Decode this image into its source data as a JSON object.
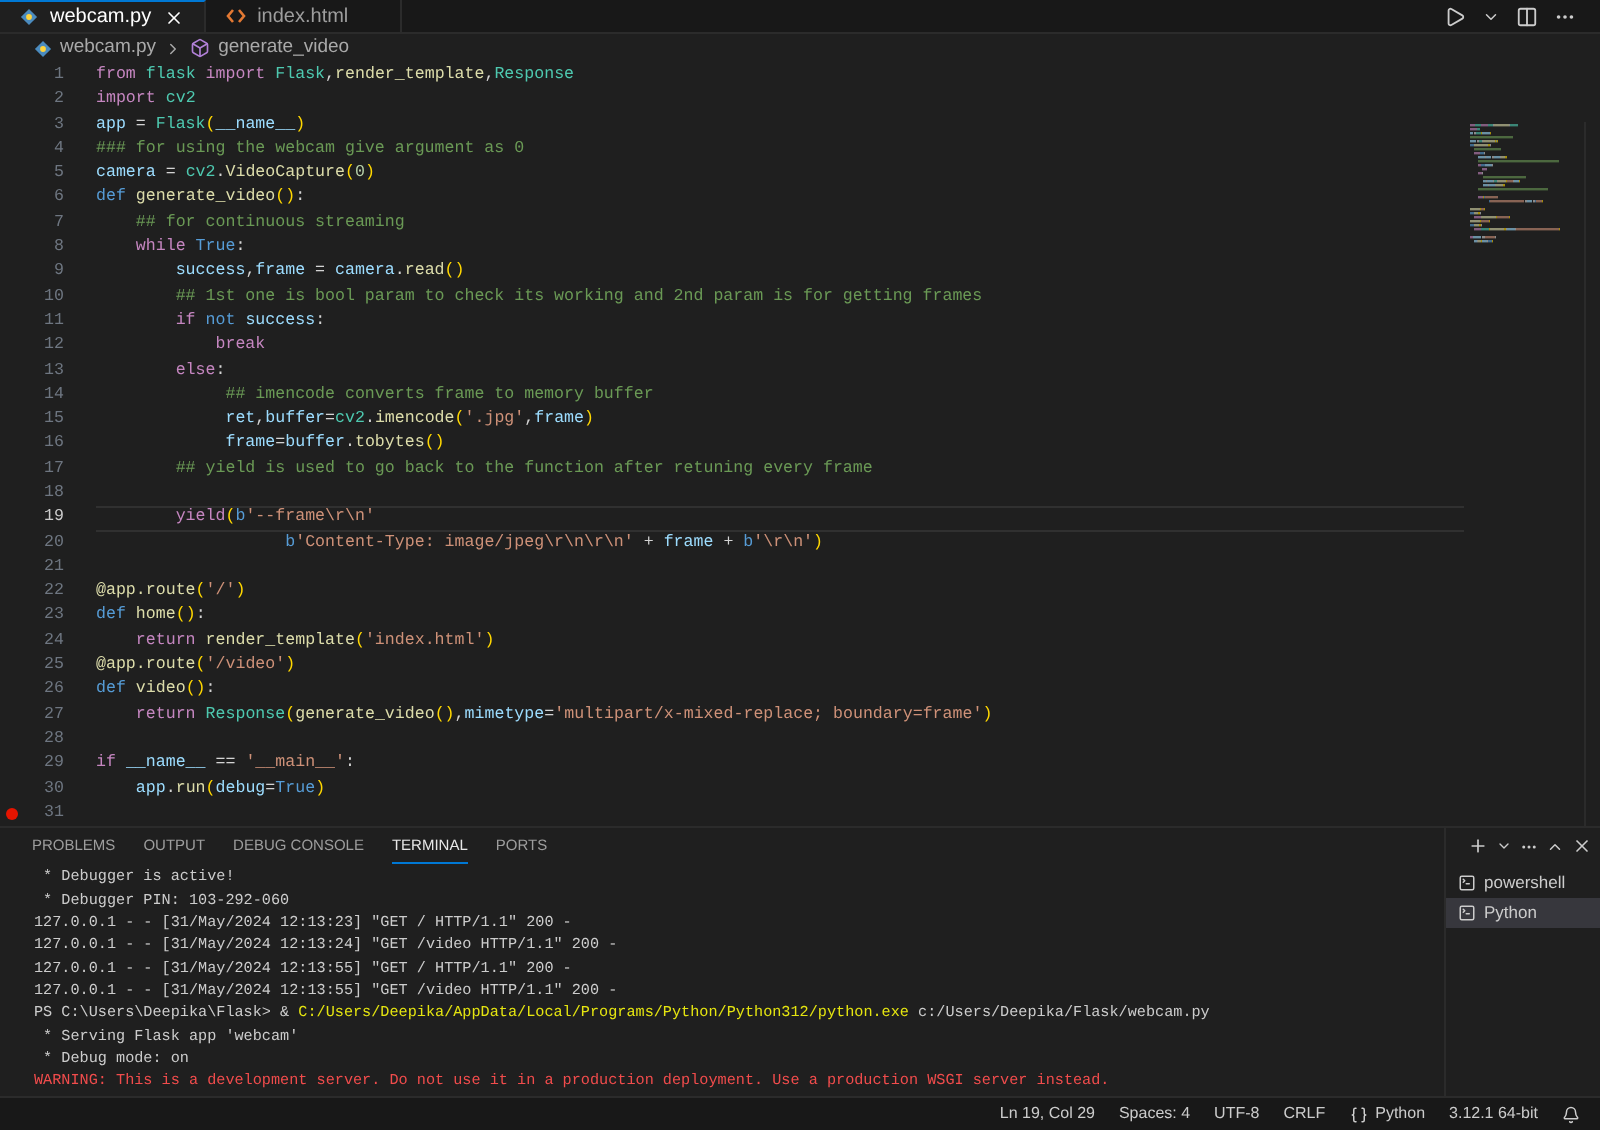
{
  "editor_tabs": [
    {
      "label": "webcam.py",
      "kind": "python",
      "selected": true
    },
    {
      "label": "index.html",
      "kind": "html",
      "selected": false
    }
  ],
  "breadcrumb": [
    {
      "label": "webcam.py",
      "kind": "python"
    },
    {
      "label": "generate_video",
      "kind": "symbol"
    }
  ],
  "code_lines": [
    {
      "number": "1",
      "current": false,
      "breakpoint": false,
      "tokens": [
        {
          "kind": "kw",
          "text": "from "
        },
        {
          "kind": "cls",
          "text": "flask "
        },
        {
          "kind": "kw",
          "text": "import "
        },
        {
          "kind": "cls",
          "text": "Flask"
        },
        {
          "kind": "plain",
          "text": ","
        },
        {
          "kind": "fn",
          "text": "render_template"
        },
        {
          "kind": "plain",
          "text": ","
        },
        {
          "kind": "cls",
          "text": "Response"
        }
      ]
    },
    {
      "number": "2",
      "current": false,
      "breakpoint": false,
      "tokens": [
        {
          "kind": "kw",
          "text": "import "
        },
        {
          "kind": "cls",
          "text": "cv2"
        }
      ]
    },
    {
      "number": "3",
      "current": false,
      "breakpoint": false,
      "tokens": [
        {
          "kind": "var",
          "text": "app"
        },
        {
          "kind": "plain",
          "text": " = "
        },
        {
          "kind": "cls",
          "text": "Flask"
        },
        {
          "kind": "br",
          "text": "("
        },
        {
          "kind": "var",
          "text": "__name__"
        },
        {
          "kind": "br",
          "text": ")"
        }
      ]
    },
    {
      "number": "4",
      "current": false,
      "breakpoint": false,
      "tokens": [
        {
          "kind": "cm",
          "text": "### for using the webcam give argument as 0"
        }
      ]
    },
    {
      "number": "5",
      "current": false,
      "breakpoint": false,
      "tokens": [
        {
          "kind": "var",
          "text": "camera"
        },
        {
          "kind": "plain",
          "text": " = "
        },
        {
          "kind": "cls",
          "text": "cv2"
        },
        {
          "kind": "plain",
          "text": "."
        },
        {
          "kind": "fn",
          "text": "VideoCapture"
        },
        {
          "kind": "br",
          "text": "("
        },
        {
          "kind": "num",
          "text": "0"
        },
        {
          "kind": "br",
          "text": ")"
        }
      ]
    },
    {
      "number": "6",
      "current": false,
      "breakpoint": false,
      "tokens": [
        {
          "kind": "def",
          "text": "def "
        },
        {
          "kind": "fn",
          "text": "generate_video"
        },
        {
          "kind": "br",
          "text": "()"
        },
        {
          "kind": "plain",
          "text": ":"
        }
      ]
    },
    {
      "number": "7",
      "current": false,
      "breakpoint": false,
      "tokens": [
        {
          "kind": "cm",
          "text": "    ## for continuous streaming"
        }
      ]
    },
    {
      "number": "8",
      "current": false,
      "breakpoint": false,
      "tokens": [
        {
          "kind": "kw",
          "text": "    while "
        },
        {
          "kind": "def",
          "text": "True"
        },
        {
          "kind": "plain",
          "text": ":"
        }
      ]
    },
    {
      "number": "9",
      "current": false,
      "breakpoint": false,
      "tokens": [
        {
          "kind": "var",
          "text": "        success"
        },
        {
          "kind": "plain",
          "text": ","
        },
        {
          "kind": "var",
          "text": "frame"
        },
        {
          "kind": "plain",
          "text": " = "
        },
        {
          "kind": "var",
          "text": "camera"
        },
        {
          "kind": "plain",
          "text": "."
        },
        {
          "kind": "fn",
          "text": "read"
        },
        {
          "kind": "br",
          "text": "()"
        }
      ]
    },
    {
      "number": "10",
      "current": false,
      "breakpoint": false,
      "tokens": [
        {
          "kind": "cm",
          "text": "        ## 1st one is bool param to check its working and 2nd param is for getting frames"
        }
      ]
    },
    {
      "number": "11",
      "current": false,
      "breakpoint": false,
      "tokens": [
        {
          "kind": "kw",
          "text": "        if "
        },
        {
          "kind": "def",
          "text": "not "
        },
        {
          "kind": "var",
          "text": "success"
        },
        {
          "kind": "plain",
          "text": ":"
        }
      ]
    },
    {
      "number": "12",
      "current": false,
      "breakpoint": false,
      "tokens": [
        {
          "kind": "kw",
          "text": "            break"
        }
      ]
    },
    {
      "number": "13",
      "current": false,
      "breakpoint": false,
      "tokens": [
        {
          "kind": "kw",
          "text": "        else"
        },
        {
          "kind": "plain",
          "text": ":"
        }
      ]
    },
    {
      "number": "14",
      "current": false,
      "breakpoint": false,
      "tokens": [
        {
          "kind": "cm",
          "text": "             ## imencode converts frame to memory buffer"
        }
      ]
    },
    {
      "number": "15",
      "current": false,
      "breakpoint": false,
      "tokens": [
        {
          "kind": "var",
          "text": "             ret"
        },
        {
          "kind": "plain",
          "text": ","
        },
        {
          "kind": "var",
          "text": "buffer"
        },
        {
          "kind": "plain",
          "text": "="
        },
        {
          "kind": "cls",
          "text": "cv2"
        },
        {
          "kind": "plain",
          "text": "."
        },
        {
          "kind": "fn",
          "text": "imencode"
        },
        {
          "kind": "br",
          "text": "("
        },
        {
          "kind": "str",
          "text": "'.jpg'"
        },
        {
          "kind": "plain",
          "text": ","
        },
        {
          "kind": "var",
          "text": "frame"
        },
        {
          "kind": "br",
          "text": ")"
        }
      ]
    },
    {
      "number": "16",
      "current": false,
      "breakpoint": false,
      "tokens": [
        {
          "kind": "var",
          "text": "             frame"
        },
        {
          "kind": "plain",
          "text": "="
        },
        {
          "kind": "var",
          "text": "buffer"
        },
        {
          "kind": "plain",
          "text": "."
        },
        {
          "kind": "fn",
          "text": "tobytes"
        },
        {
          "kind": "br",
          "text": "()"
        }
      ]
    },
    {
      "number": "17",
      "current": false,
      "breakpoint": false,
      "tokens": [
        {
          "kind": "cm",
          "text": "        ## yield is used to go back to the function after retuning every frame"
        }
      ]
    },
    {
      "number": "18",
      "current": false,
      "breakpoint": false
    },
    {
      "number": "19",
      "current": true,
      "breakpoint": false,
      "tokens": [
        {
          "kind": "kw",
          "text": "        yield"
        },
        {
          "kind": "br",
          "text": "("
        },
        {
          "kind": "def",
          "text": "b"
        },
        {
          "kind": "str",
          "text": "'--frame\\r\\n'"
        }
      ]
    },
    {
      "number": "20",
      "current": false,
      "breakpoint": false,
      "tokens": [
        {
          "kind": "def",
          "text": "                   b"
        },
        {
          "kind": "str",
          "text": "'Content-Type: image/jpeg\\r\\n\\r\\n'"
        },
        {
          "kind": "plain",
          "text": " + "
        },
        {
          "kind": "var",
          "text": "frame"
        },
        {
          "kind": "plain",
          "text": " + "
        },
        {
          "kind": "def",
          "text": "b"
        },
        {
          "kind": "str",
          "text": "'\\r\\n'"
        },
        {
          "kind": "br",
          "text": ")"
        }
      ]
    },
    {
      "number": "21",
      "current": false,
      "breakpoint": false
    },
    {
      "number": "22",
      "current": false,
      "breakpoint": false,
      "tokens": [
        {
          "kind": "fn",
          "text": "@app.route"
        },
        {
          "kind": "br",
          "text": "("
        },
        {
          "kind": "str",
          "text": "'/'"
        },
        {
          "kind": "br",
          "text": ")"
        }
      ]
    },
    {
      "number": "23",
      "current": false,
      "breakpoint": false,
      "tokens": [
        {
          "kind": "def",
          "text": "def "
        },
        {
          "kind": "fn",
          "text": "home"
        },
        {
          "kind": "br",
          "text": "()"
        },
        {
          "kind": "plain",
          "text": ":"
        }
      ]
    },
    {
      "number": "24",
      "current": false,
      "breakpoint": false,
      "tokens": [
        {
          "kind": "kw",
          "text": "    return "
        },
        {
          "kind": "fn",
          "text": "render_template"
        },
        {
          "kind": "br",
          "text": "("
        },
        {
          "kind": "str",
          "text": "'index.html'"
        },
        {
          "kind": "br",
          "text": ")"
        }
      ]
    },
    {
      "number": "25",
      "current": false,
      "breakpoint": false,
      "tokens": [
        {
          "kind": "fn",
          "text": "@app.route"
        },
        {
          "kind": "br",
          "text": "("
        },
        {
          "kind": "str",
          "text": "'/video'"
        },
        {
          "kind": "br",
          "text": ")"
        }
      ]
    },
    {
      "number": "26",
      "current": false,
      "breakpoint": false,
      "tokens": [
        {
          "kind": "def",
          "text": "def "
        },
        {
          "kind": "fn",
          "text": "video"
        },
        {
          "kind": "br",
          "text": "()"
        },
        {
          "kind": "plain",
          "text": ":"
        }
      ]
    },
    {
      "number": "27",
      "current": false,
      "breakpoint": false,
      "tokens": [
        {
          "kind": "kw",
          "text": "    return "
        },
        {
          "kind": "cls",
          "text": "Response"
        },
        {
          "kind": "br",
          "text": "("
        },
        {
          "kind": "fn",
          "text": "generate_video"
        },
        {
          "kind": "br",
          "text": "()"
        },
        {
          "kind": "plain",
          "text": ","
        },
        {
          "kind": "var",
          "text": "mimetype"
        },
        {
          "kind": "plain",
          "text": "="
        },
        {
          "kind": "str",
          "text": "'multipart/x-mixed-replace; boundary=frame'"
        },
        {
          "kind": "br",
          "text": ")"
        }
      ]
    },
    {
      "number": "28",
      "current": false,
      "breakpoint": false
    },
    {
      "number": "29",
      "current": false,
      "breakpoint": false,
      "tokens": [
        {
          "kind": "kw",
          "text": "if "
        },
        {
          "kind": "var",
          "text": "__name__"
        },
        {
          "kind": "plain",
          "text": " == "
        },
        {
          "kind": "str",
          "text": "'__main__'"
        },
        {
          "kind": "plain",
          "text": ":"
        }
      ]
    },
    {
      "number": "30",
      "current": false,
      "breakpoint": false,
      "tokens": [
        {
          "kind": "var",
          "text": "    app"
        },
        {
          "kind": "plain",
          "text": "."
        },
        {
          "kind": "fn",
          "text": "run"
        },
        {
          "kind": "br",
          "text": "("
        },
        {
          "kind": "var",
          "text": "debug"
        },
        {
          "kind": "plain",
          "text": "="
        },
        {
          "kind": "def",
          "text": "True"
        },
        {
          "kind": "br",
          "text": ")"
        }
      ]
    },
    {
      "number": "31",
      "current": false,
      "breakpoint": true
    }
  ],
  "panel_tabs": [
    {
      "label": "PROBLEMS",
      "selected": false
    },
    {
      "label": "OUTPUT",
      "selected": false
    },
    {
      "label": "DEBUG CONSOLE",
      "selected": false
    },
    {
      "label": "TERMINAL",
      "selected": true
    },
    {
      "label": "PORTS",
      "selected": false
    }
  ],
  "terminal_lines": [
    [
      {
        "kind": "plain",
        "text": " * Debugger is active!"
      }
    ],
    [
      {
        "kind": "plain",
        "text": " * Debugger PIN: 103-292-060"
      }
    ],
    [
      {
        "kind": "plain",
        "text": "127.0.0.1 - - [31/May/2024 12:13:23] \"GET / HTTP/1.1\" 200 -"
      }
    ],
    [
      {
        "kind": "plain",
        "text": "127.0.0.1 - - [31/May/2024 12:13:24] \"GET /video HTTP/1.1\" 200 -"
      }
    ],
    [
      {
        "kind": "plain",
        "text": "127.0.0.1 - - [31/May/2024 12:13:55] \"GET / HTTP/1.1\" 200 -"
      }
    ],
    [
      {
        "kind": "plain",
        "text": "127.0.0.1 - - [31/May/2024 12:13:55] \"GET /video HTTP/1.1\" 200 -"
      }
    ],
    [
      {
        "kind": "plain",
        "text": "PS C:\\Users\\Deepika\\Flask> & "
      },
      {
        "kind": "path",
        "text": "C:/Users/Deepika/AppData/Local/Programs/Python/Python312/python.exe"
      },
      {
        "kind": "plain",
        "text": " c:/Users/Deepika/Flask/webcam.py"
      }
    ],
    [
      {
        "kind": "plain",
        "text": " * Serving Flask app 'webcam'"
      }
    ],
    [
      {
        "kind": "plain",
        "text": " * Debug mode: on"
      }
    ],
    [
      {
        "kind": "warning",
        "text": "WARNING: This is a development server. Do not use it in a production deployment. Use a production WSGI server instead."
      }
    ]
  ],
  "terminals": [
    {
      "label": "powershell",
      "selected": false
    },
    {
      "label": "Python",
      "selected": true
    }
  ],
  "status_bar": [
    {
      "kind": "text",
      "label": "Ln 19, Col 29"
    },
    {
      "kind": "text",
      "label": "Spaces: 4"
    },
    {
      "kind": "text",
      "label": "UTF-8"
    },
    {
      "kind": "text",
      "label": "CRLF"
    },
    {
      "kind": "language",
      "label": "Python"
    },
    {
      "kind": "text",
      "label": "3.12.1 64-bit"
    }
  ]
}
